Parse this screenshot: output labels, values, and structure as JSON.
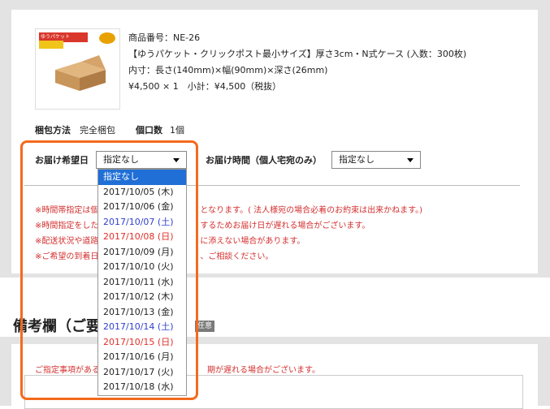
{
  "product": {
    "thumbnail_text": "ゆうパケット",
    "number": "商品番号：NE-26",
    "name": "【ゆうパケット・クリックポスト最小サイズ】厚さ3cm・N式ケース (入数：300枚)",
    "dimensions": "内寸：長さ(140mm)×幅(90mm)×深さ(26mm)",
    "price": "¥4,500 × 1　小計：¥4,500（税抜）"
  },
  "packing": {
    "label": "梱包方法",
    "value": "完全梱包"
  },
  "count": {
    "label": "個口数",
    "value": "1個"
  },
  "delivery_date": {
    "label": "お届け希望日",
    "selected": "指定なし"
  },
  "delivery_time": {
    "label": "お届け時間（個人宅宛のみ）",
    "selected": "指定なし"
  },
  "notes": [
    {
      "left": "※時間帯指定は個",
      "right": "となります。( 法人様宛の場合必着のお約束は出来かねます。)"
    },
    {
      "left": "※時間指定をした",
      "right": "するためお届け日が遅れる場合がございます。"
    },
    {
      "left": "※配送状況や道路",
      "right": "に添えない場合があります。"
    },
    {
      "left": "※ご希望の到着日",
      "right": "、ご相談ください。"
    }
  ],
  "date_options": [
    {
      "label": "指定なし",
      "kind": "selected"
    },
    {
      "label": "2017/10/05 (木)",
      "kind": "weekday"
    },
    {
      "label": "2017/10/06 (金)",
      "kind": "weekday"
    },
    {
      "label": "2017/10/07 (土)",
      "kind": "sat"
    },
    {
      "label": "2017/10/08 (日)",
      "kind": "sun"
    },
    {
      "label": "2017/10/09 (月)",
      "kind": "weekday"
    },
    {
      "label": "2017/10/10 (火)",
      "kind": "weekday"
    },
    {
      "label": "2017/10/11 (水)",
      "kind": "weekday"
    },
    {
      "label": "2017/10/12 (木)",
      "kind": "weekday"
    },
    {
      "label": "2017/10/13 (金)",
      "kind": "weekday"
    },
    {
      "label": "2017/10/14 (土)",
      "kind": "sat"
    },
    {
      "label": "2017/10/15 (日)",
      "kind": "sun"
    },
    {
      "label": "2017/10/16 (月)",
      "kind": "weekday"
    },
    {
      "label": "2017/10/17 (火)",
      "kind": "weekday"
    },
    {
      "label": "2017/10/18 (水)",
      "kind": "weekday"
    }
  ],
  "remarks": {
    "heading": "備考欄（ご要望",
    "tag": "任意",
    "note_left": "ご指定事項がある",
    "note_right": "期が遅れる場合がございます。"
  },
  "colors": {
    "highlight": "#f36a1d",
    "selected": "#1f6fd6",
    "saturday": "#2f3fd0",
    "sunday": "#e0302a",
    "warning": "#d43030"
  }
}
